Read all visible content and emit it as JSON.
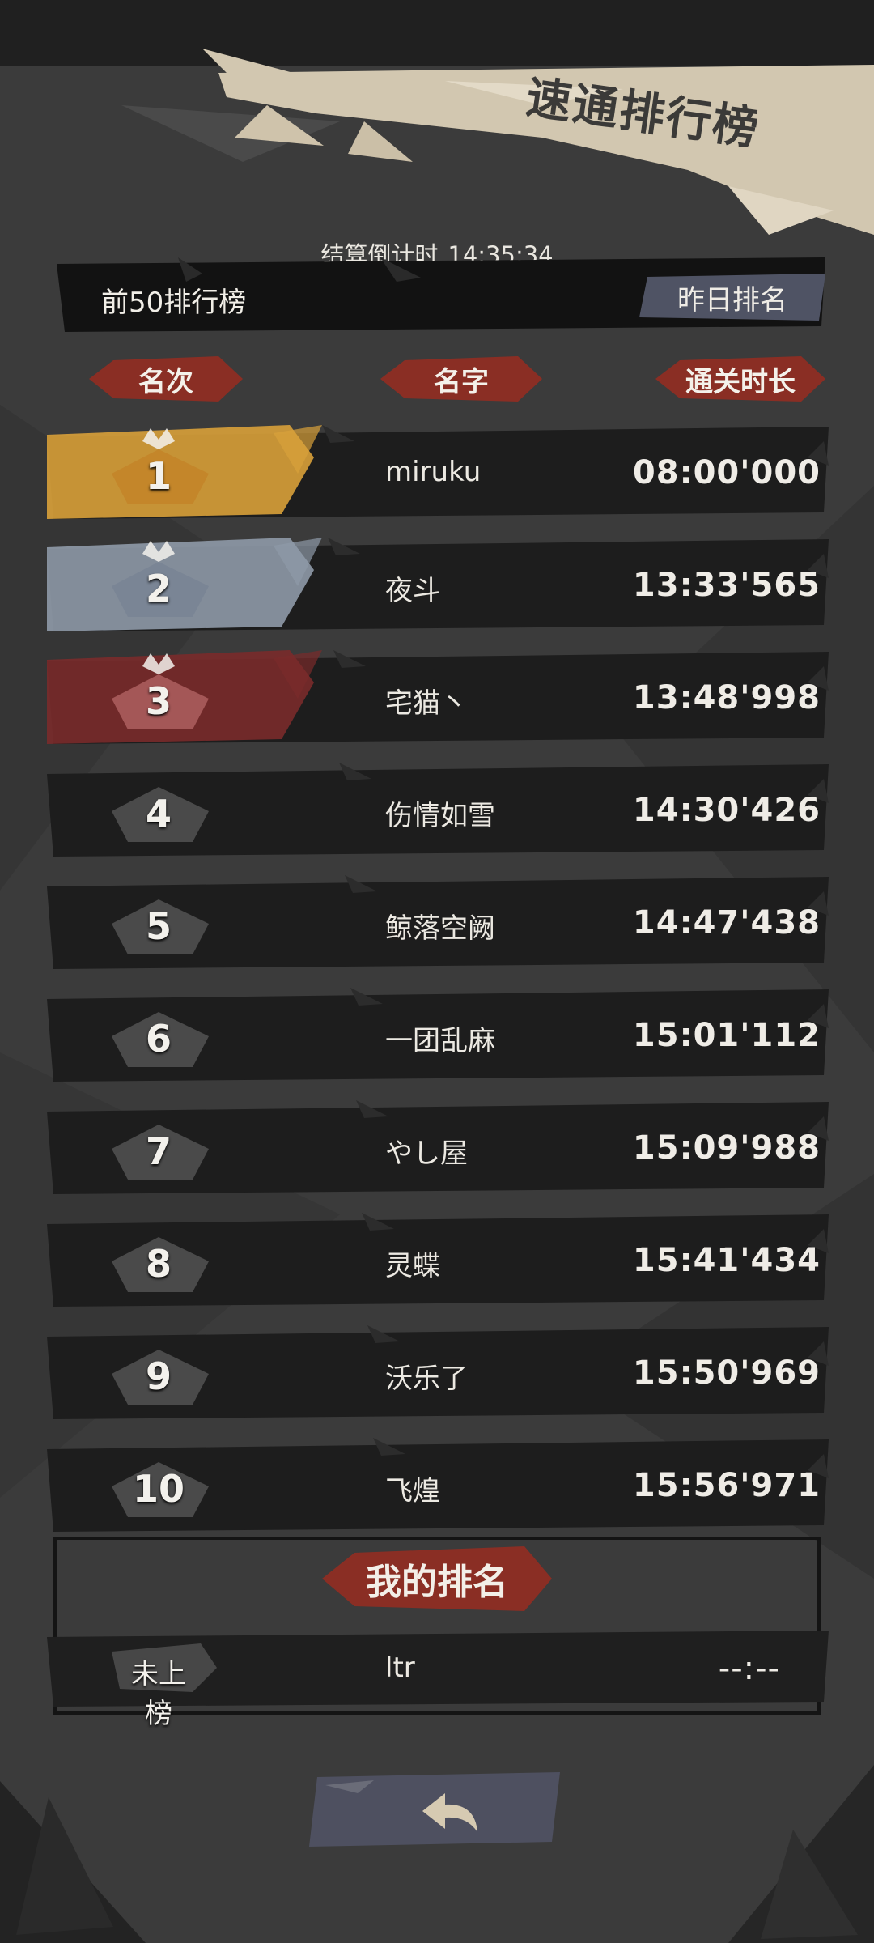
{
  "header": {
    "title": "速通排行榜",
    "countdown_label": "结算倒计时",
    "countdown_value": "14:35:34",
    "board_title": "前50排行榜",
    "yesterday_button": "昨日排名"
  },
  "columns": {
    "rank": "名次",
    "name": "名字",
    "time": "通关时长"
  },
  "leaderboard": [
    {
      "rank": "1",
      "name": "miruku",
      "time": "08:00'000"
    },
    {
      "rank": "2",
      "name": "夜斗",
      "time": "13:33'565"
    },
    {
      "rank": "3",
      "name": "宅猫丶",
      "time": "13:48'998"
    },
    {
      "rank": "4",
      "name": "伤情如雪",
      "time": "14:30'426"
    },
    {
      "rank": "5",
      "name": "鲸落空阙",
      "time": "14:47'438"
    },
    {
      "rank": "6",
      "name": "一团乱麻",
      "time": "15:01'112"
    },
    {
      "rank": "7",
      "name": "やし屋",
      "time": "15:09'988"
    },
    {
      "rank": "8",
      "name": "灵蝶",
      "time": "15:41'434"
    },
    {
      "rank": "9",
      "name": "沃乐了",
      "time": "15:50'969"
    },
    {
      "rank": "10",
      "name": "飞煌",
      "time": "15:56'971"
    }
  ],
  "my_rank": {
    "title": "我的排名",
    "rank": "未上榜",
    "name": "ltr",
    "time": "--:--"
  },
  "icons": {
    "back": "back-arrow-icon",
    "crown": "crown-icon"
  },
  "colors": {
    "gold": "#d9a13a",
    "silver": "#8f9aa8",
    "bronze": "#7a2b2b",
    "accent_red": "#8a2e24",
    "banner": "#d6cbb5"
  }
}
